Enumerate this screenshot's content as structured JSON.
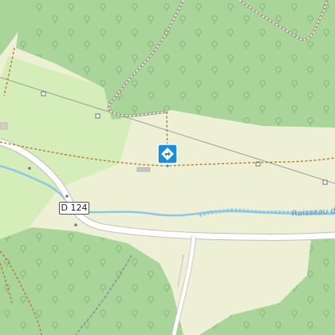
{
  "map": {
    "road_ref": "D 124",
    "stream_label": "Ruisseau de",
    "colors": {
      "base_meadow": "#eef0d6",
      "forest": "#a9d59a",
      "forest_tree": "#86bd78",
      "grassland": "#d5edb8",
      "road": "#ffffff",
      "road_casing": "#bdbdbd",
      "path": "#b8792b",
      "track_dash": "#ffffff",
      "water": "#8dc6e6",
      "water_label": "#5b9ec9",
      "power_line": "#8c8c8c",
      "marker": "#1a8ed8"
    },
    "marker": {
      "icon": "directions-diamond-icon"
    }
  }
}
